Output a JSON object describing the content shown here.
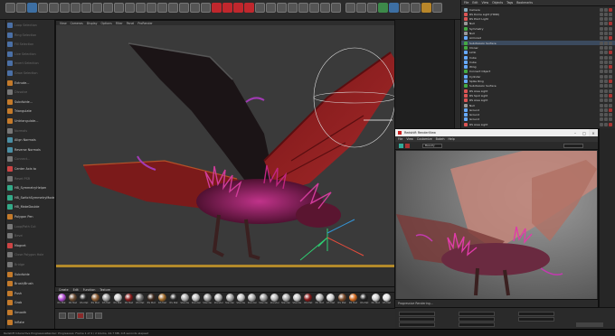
{
  "viewport_menu": [
    "View",
    "Cameras",
    "Display",
    "Options",
    "Filter",
    "Panel",
    "ProRender"
  ],
  "left_tools": [
    {
      "label": "Loop Selection",
      "dim": true
    },
    {
      "label": "Ring Selection",
      "dim": true
    },
    {
      "label": "Fill Selection",
      "dim": true
    },
    {
      "label": "Live Selection",
      "dim": true
    },
    {
      "label": "Invert Selection",
      "dim": true
    },
    {
      "label": "Grow Selection",
      "dim": true
    },
    {
      "label": "Extrude...",
      "dim": false
    },
    {
      "label": "Dissolve",
      "dim": true
    },
    {
      "label": "Subdivide...",
      "dim": false
    },
    {
      "label": "Triangulate",
      "dim": false
    },
    {
      "label": "Untriangulate...",
      "dim": false
    },
    {
      "label": "Normals",
      "dim": true
    },
    {
      "label": "Align Normals",
      "dim": false
    },
    {
      "label": "Reverse Normals",
      "dim": false
    },
    {
      "label": "Connect...",
      "dim": true
    },
    {
      "label": "Center Axis to",
      "dim": false
    },
    {
      "label": "Reset PSR",
      "dim": true
    },
    {
      "label": "HB_SymmetryHelper",
      "dim": false
    },
    {
      "label": "HB_SwitchSymmetryMode",
      "dim": false
    },
    {
      "label": "HB_MakeDouble",
      "dim": false
    },
    {
      "label": "Polygon Pen",
      "dim": false
    },
    {
      "label": "Loop/Path Cut",
      "dim": true
    },
    {
      "label": "Bevel",
      "dim": true
    },
    {
      "label": "Magnet",
      "dim": false
    },
    {
      "label": "Close Polygon Hole",
      "dim": true
    },
    {
      "label": "Bridge",
      "dim": true
    },
    {
      "label": "Subdivide",
      "dim": false
    },
    {
      "label": "Brush/Brush",
      "dim": false
    },
    {
      "label": "Push",
      "dim": false
    },
    {
      "label": "Grab",
      "dim": false
    },
    {
      "label": "Smooth",
      "dim": false
    },
    {
      "label": "Inflate",
      "dim": false
    }
  ],
  "material_menu": [
    "Create",
    "Edit",
    "Function",
    "Texture"
  ],
  "materials": [
    {
      "label": "RS Mat",
      "color": "#b04cd0"
    },
    {
      "label": "RS Mat",
      "color": "#6a4a30"
    },
    {
      "label": "RS Mat",
      "color": "#2a2a2a"
    },
    {
      "label": "RS Mat",
      "color": "#8a5a30"
    },
    {
      "label": "RS Mat",
      "color": "#9a9a9a"
    },
    {
      "label": "RS Mat",
      "color": "#c8c8c8"
    },
    {
      "label": "RS Mat",
      "color": "#8a1c1c"
    },
    {
      "label": "RS Mat",
      "color": "#6e6e6e"
    },
    {
      "label": "RS Mat",
      "color": "#3e2a1e"
    },
    {
      "label": "RS Mat",
      "color": "#a06a2a"
    },
    {
      "label": "RS Mat",
      "color": "#2a2a2a"
    },
    {
      "label": "Standar",
      "color": "#aaaaaa"
    },
    {
      "label": "Standar",
      "color": "#bbbbbb"
    },
    {
      "label": "Standar",
      "color": "#999999"
    },
    {
      "label": "Standar",
      "color": "#b0b0b0"
    },
    {
      "label": "Standar",
      "color": "#a0a0a0"
    },
    {
      "label": "Standar",
      "color": "#c0c0c0"
    },
    {
      "label": "Standar",
      "color": "#aaaaaa"
    },
    {
      "label": "Standar",
      "color": "#9a9a9a"
    },
    {
      "label": "Standar",
      "color": "#b8b8b8"
    },
    {
      "label": "Standar",
      "color": "#a8a8a8"
    },
    {
      "label": "Standar",
      "color": "#c4c4c4"
    },
    {
      "label": "RS Mat",
      "color": "#8a1a1a"
    },
    {
      "label": "RS Mat",
      "color": "#b4b4b4"
    },
    {
      "label": "RS Mat",
      "color": "#d0d0d0"
    },
    {
      "label": "RS Mat",
      "color": "#7a4a2a"
    },
    {
      "label": "RS Mat",
      "color": "#d2691e"
    },
    {
      "label": "RS Mat",
      "color": "#222222"
    },
    {
      "label": "RS Mat",
      "color": "#cfcfcf"
    },
    {
      "label": "RS Mat",
      "color": "#e0e0e0"
    }
  ],
  "object_manager": {
    "menu": [
      "File",
      "Edit",
      "View",
      "Objects",
      "Tags",
      "Bookmarks"
    ],
    "rows": [
      {
        "name": "Camera",
        "color": "#8ab",
        "sel": false
      },
      {
        "name": "RS Dome Light (HDRI)",
        "color": "#d55",
        "sel": false
      },
      {
        "name": "RS Point Light",
        "color": "#d55",
        "sel": false
      },
      {
        "name": "Null",
        "color": "#999",
        "sel": false
      },
      {
        "name": "Symmetry",
        "color": "#4a4",
        "sel": false
      },
      {
        "name": "Null",
        "color": "#999",
        "sel": false
      },
      {
        "name": "Armored",
        "color": "#6af",
        "sel": false
      },
      {
        "name": "Subdivision Surface",
        "color": "#4a4",
        "sel": true
      },
      {
        "name": "Cloner",
        "color": "#4a4",
        "sel": false
      },
      {
        "name": "Limb",
        "color": "#6af",
        "sel": false
      },
      {
        "name": "Cube",
        "color": "#6af",
        "sel": false
      },
      {
        "name": "Cube",
        "color": "#6af",
        "sel": false
      },
      {
        "name": "Wing",
        "color": "#6af",
        "sel": false
      },
      {
        "name": "Connect Object",
        "color": "#4a4",
        "sel": false
      },
      {
        "name": "Cylinder",
        "color": "#6af",
        "sel": false
      },
      {
        "name": "Spike Ring",
        "color": "#6af",
        "sel": false
      },
      {
        "name": "Subdivision Surface",
        "color": "#4a4",
        "sel": false
      },
      {
        "name": "RS Area Light",
        "color": "#d55",
        "sel": false
      },
      {
        "name": "RS Spot Light",
        "color": "#d55",
        "sel": false
      },
      {
        "name": "RS Area Light",
        "color": "#d55",
        "sel": false
      },
      {
        "name": "Null",
        "color": "#999",
        "sel": false
      },
      {
        "name": "Ground",
        "color": "#6af",
        "sel": false
      },
      {
        "name": "Ground",
        "color": "#6af",
        "sel": false
      },
      {
        "name": "Ground",
        "color": "#6af",
        "sel": false
      },
      {
        "name": "RS Area Light",
        "color": "#d55",
        "sel": false
      }
    ]
  },
  "render_window": {
    "title": "Redshift RenderView",
    "menu": [
      "File",
      "View",
      "Customize",
      "Bokeh",
      "Help"
    ],
    "camera_select": "Beauty",
    "status": "Progressive Rendering..."
  },
  "status_bar": "Redshift Interactive ProgressiveRender: Progressive: Frame 1 of 2 / 2 blocks, 44.7 MB, 0.8 seconds elapsed"
}
